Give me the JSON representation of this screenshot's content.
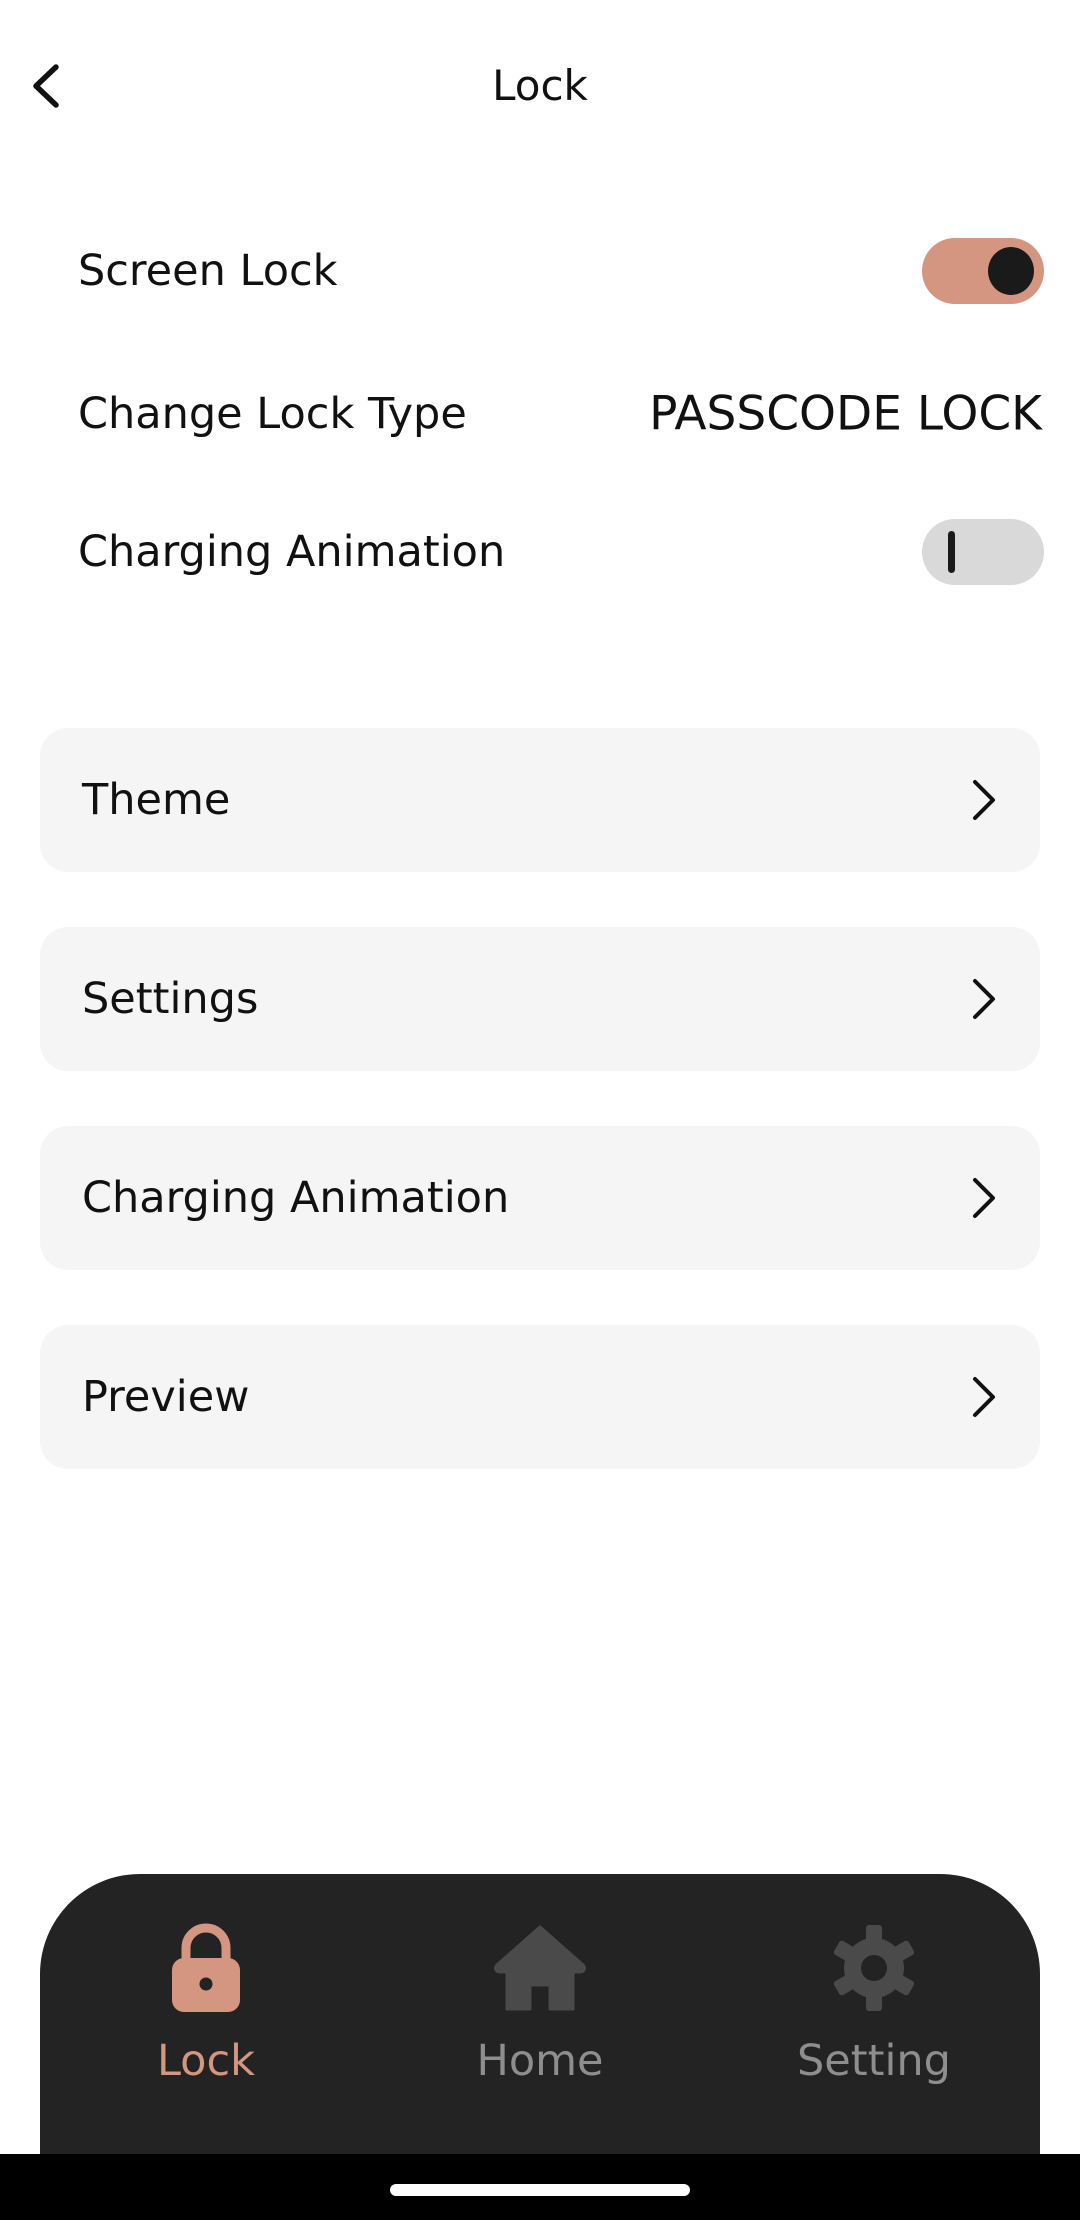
{
  "header": {
    "title": "Lock",
    "back_icon": "chevron-left-icon"
  },
  "settings": {
    "screen_lock": {
      "label": "Screen Lock",
      "enabled": true
    },
    "lock_type": {
      "label": "Change Lock Type",
      "value": "PASSCODE LOCK"
    },
    "charging_animation": {
      "label": "Charging Animation",
      "enabled": false
    }
  },
  "menu": [
    {
      "label": "Theme",
      "icon": "chevron-right-icon"
    },
    {
      "label": "Settings",
      "icon": "chevron-right-icon"
    },
    {
      "label": "Charging Animation",
      "icon": "chevron-right-icon"
    },
    {
      "label": "Preview",
      "icon": "chevron-right-icon"
    }
  ],
  "bottom_nav": {
    "items": [
      {
        "label": "Lock",
        "icon": "lock-icon",
        "active": true
      },
      {
        "label": "Home",
        "icon": "home-icon",
        "active": false
      },
      {
        "label": "Setting",
        "icon": "gear-icon",
        "active": false
      }
    ]
  },
  "colors": {
    "accent": "#d49581",
    "nav_background": "#232323",
    "card_background": "#f5f5f5",
    "inactive_icon": "#4a4a4a",
    "inactive_label": "#8e8e8e",
    "toggle_off": "#d9d9d9"
  }
}
